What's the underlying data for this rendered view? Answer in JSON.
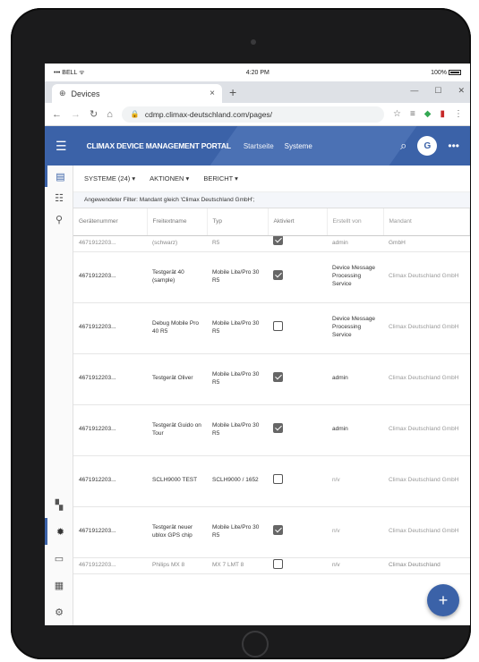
{
  "status_bar": {
    "carrier": "BELL",
    "time": "4:20 PM",
    "battery": "100%"
  },
  "browser": {
    "tab_title": "Devices",
    "url": "cdmp.climax-deutschland.com/pages/"
  },
  "app": {
    "title": "CLIMAX DEVICE MANAGEMENT PORTAL",
    "nav": [
      "Startseite",
      "Systeme"
    ],
    "avatar": "G"
  },
  "toolbar": {
    "systems": "SYSTEME (24) ▾",
    "actions": "AKTIONEN ▾",
    "report": "BERICHT ▾"
  },
  "filter_text": "Angewendeter Filter: Mandant gleich 'Climax Deutschland GmbH';",
  "table": {
    "columns": [
      "Gerätenummer",
      "Freitextname",
      "Typ",
      "Aktiviert",
      "Erstellt von",
      "Mandant"
    ],
    "partial_top": {
      "id": "4671912203...",
      "name": "(schwarz)",
      "type": "R5",
      "active": true,
      "creator": "admin",
      "tenant": "GmbH"
    },
    "rows": [
      {
        "id": "4671912203...",
        "name": "Testgerät 40 (sample)",
        "type": "Mobile Lite/Pro 30 R5",
        "active": true,
        "creator": "Device Message Processing Service",
        "tenant": "Climax Deutschland GmbH"
      },
      {
        "id": "4671912203...",
        "name": "Debug Mobile Pro 40 R5",
        "type": "Mobile Lite/Pro 30 R5",
        "active": false,
        "creator": "Device Message Processing Service",
        "tenant": "Climax Deutschland GmbH"
      },
      {
        "id": "4671912203...",
        "name": "Testgerät Oliver",
        "type": "Mobile Lite/Pro 30 R5",
        "active": true,
        "creator": "admin",
        "tenant": "Climax Deutschland GmbH"
      },
      {
        "id": "4671912203...",
        "name": "Testgerät Guido on Tour",
        "type": "Mobile Lite/Pro 30 R5",
        "active": true,
        "creator": "admin",
        "tenant": "Climax Deutschland GmbH"
      },
      {
        "id": "4671912203...",
        "name": "SCLH9000 TEST",
        "type": "SCLH9000 / 1652",
        "active": false,
        "creator": "n/v",
        "tenant": "Climax Deutschland GmbH"
      },
      {
        "id": "4671912203...",
        "name": "Testgerät neuer ublox GPS chip",
        "type": "Mobile Lite/Pro 30 R5",
        "active": true,
        "creator": "n/v",
        "tenant": "Climax Deutschland GmbH"
      }
    ],
    "partial_bottom": {
      "id": "4671912203...",
      "name": "Philips MX 8",
      "type": "MX 7 LMT 8",
      "active": false,
      "creator": "n/v",
      "tenant": "Climax Deutschland"
    }
  },
  "fab_label": "+"
}
